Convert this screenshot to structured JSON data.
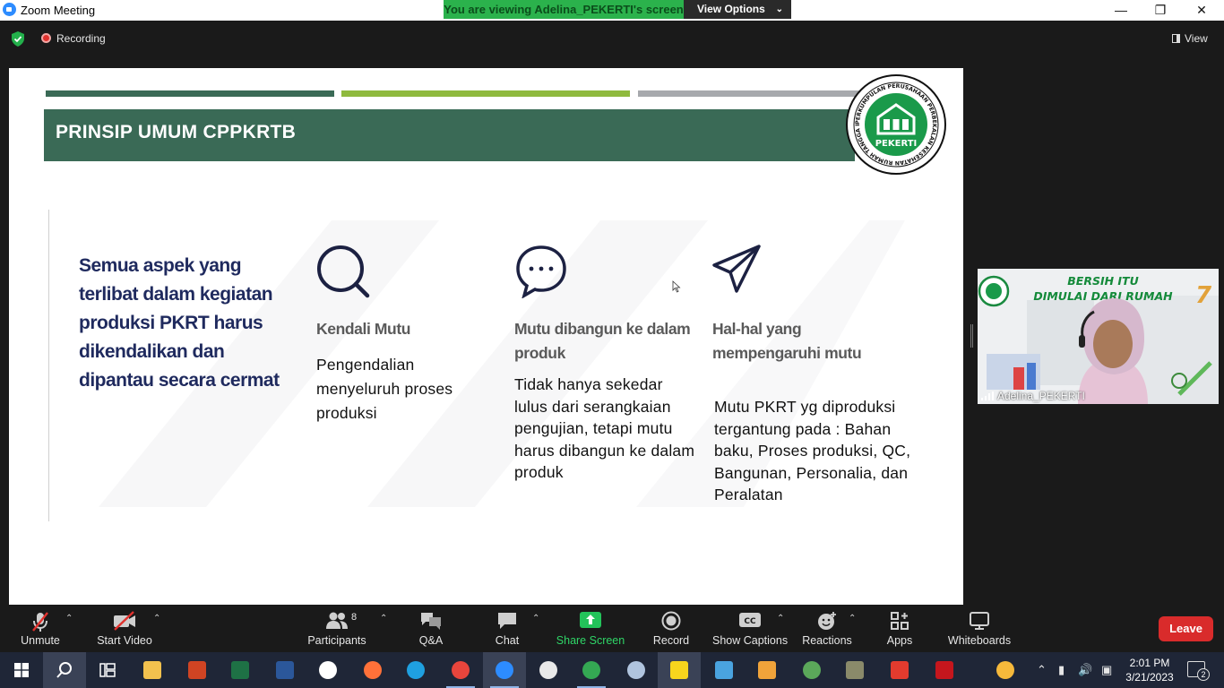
{
  "window": {
    "title": "Zoom Meeting",
    "viewing_banner": "You are viewing Adelina_PEKERTI's screen",
    "view_options": "View Options"
  },
  "meeting_bar": {
    "recording": "Recording",
    "view": "View"
  },
  "slide": {
    "title": "PRINSIP UMUM CPPKRTB",
    "logo_text": "PEKERTI",
    "logo_ring_text": "PERKUMPULAN PERUSAHAAN PERBEKALAN KESEHATAN RUMAH TANGGA INDONESIA",
    "stripe_colors": [
      "#3a6a56",
      "#8fba3e",
      "#a7a9ad"
    ],
    "statement": "Semua aspek yang terlibat dalam kegiatan produksi PKRT harus dikendalikan dan dipantau secara cermat",
    "columns": [
      {
        "icon": "search-icon",
        "heading": "Kendali Mutu",
        "body": "Pengendalian menyeluruh proses produksi"
      },
      {
        "icon": "chat-bubble-icon",
        "heading": "Mutu dibangun ke dalam produk",
        "body": "Tidak hanya sekedar lulus dari serangkaian pengujian, tetapi mutu harus dibangun ke dalam produk"
      },
      {
        "icon": "paper-plane-icon",
        "heading": "Hal-hal yang mempengaruhi mutu",
        "body": "Mutu PKRT yg diproduksi tergantung pada : Bahan baku, Proses produksi, QC, Bangunan, Personalia, dan Peralatan"
      }
    ]
  },
  "video": {
    "participant_name": "Adelina_PEKERTI",
    "banner_line1": "BERSIH ITU",
    "banner_line2": "DIMULAI DARI RUMAH"
  },
  "toolbar": {
    "unmute": "Unmute",
    "start_video": "Start Video",
    "participants": "Participants",
    "participants_count": "8",
    "qa": "Q&A",
    "chat": "Chat",
    "share_screen": "Share Screen",
    "record": "Record",
    "show_captions": "Show Captions",
    "reactions": "Reactions",
    "apps": "Apps",
    "whiteboards": "Whiteboards",
    "leave": "Leave"
  },
  "taskbar": {
    "time": "2:01 PM",
    "date": "3/21/2023",
    "notifications": "2"
  }
}
